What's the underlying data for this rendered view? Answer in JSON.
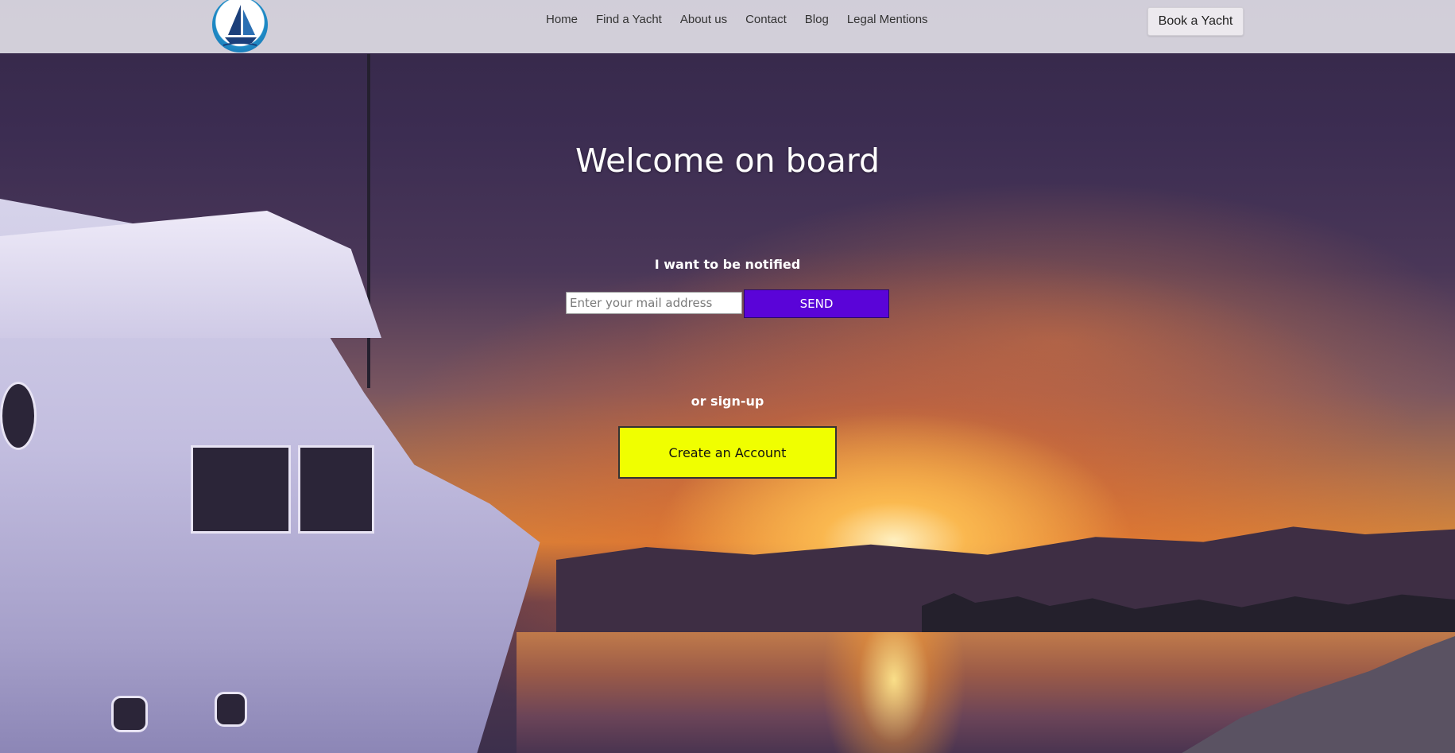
{
  "header": {
    "logo_icon": "sailboat-logo-icon",
    "nav": [
      {
        "label": "Home"
      },
      {
        "label": "Find a Yacht"
      },
      {
        "label": "About us"
      },
      {
        "label": "Contact"
      },
      {
        "label": "Blog"
      },
      {
        "label": "Legal Mentions"
      }
    ],
    "cta_label": "Book a Yacht"
  },
  "hero": {
    "title": "Welcome on board",
    "notify_label": "I want to be notified",
    "email_placeholder": "Enter your mail address",
    "email_value": "",
    "send_label": "SEND",
    "signup_label": "or sign-up",
    "create_label": "Create an Account"
  },
  "colors": {
    "header_bg": "#dedce4",
    "send_button": "#5a04d8",
    "create_button": "#f0ff00",
    "text_light": "#ffffff"
  }
}
